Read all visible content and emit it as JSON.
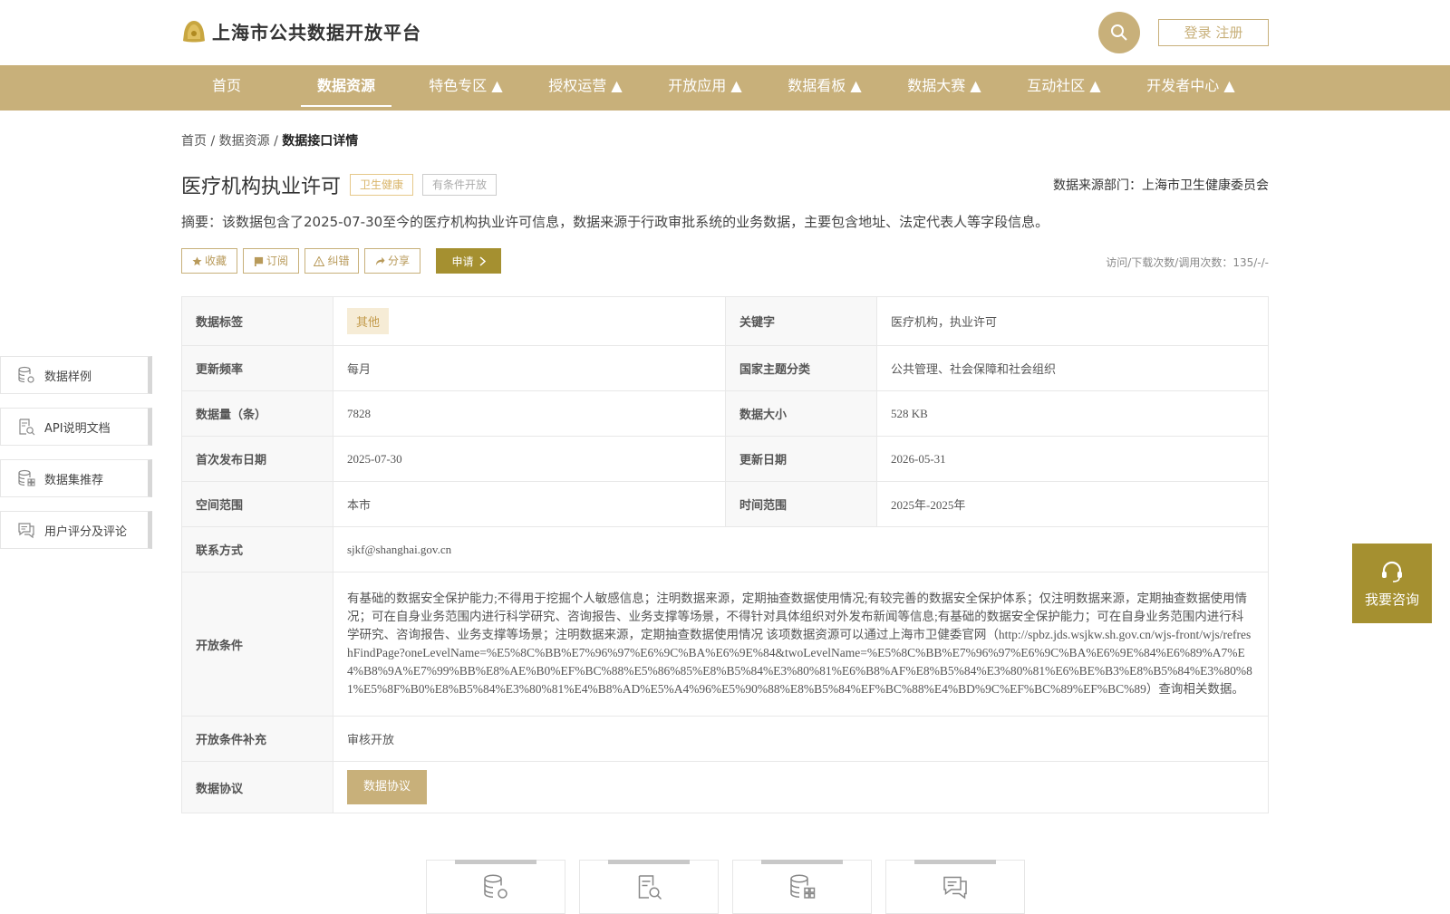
{
  "header": {
    "site_title": "上海市公共数据开放平台",
    "login_label": "登录 注册"
  },
  "nav": {
    "items": [
      {
        "label": "首页"
      },
      {
        "label": "数据资源"
      },
      {
        "label": "特色专区 ▲"
      },
      {
        "label": "授权运营 ▲"
      },
      {
        "label": "开放应用 ▲"
      },
      {
        "label": "数据看板 ▲"
      },
      {
        "label": "数据大赛 ▲"
      },
      {
        "label": "互动社区 ▲"
      },
      {
        "label": "开发者中心 ▲"
      }
    ],
    "active_index": 1
  },
  "breadcrumb": {
    "home": "首页",
    "sep1": "/",
    "section": "数据资源",
    "sep2": "/",
    "current": "数据接口详情"
  },
  "detail": {
    "title": "医疗机构执业许可",
    "tag_category": "卫生健康",
    "tag_open": "有条件开放",
    "source": "数据来源部门：上海市卫生健康委员会",
    "summary": "摘要：该数据包含了2025-07-30至今的医疗机构执业许可信息，数据来源于行政审批系统的业务数据，主要包含地址、法定代表人等字段信息。",
    "actions": {
      "collect": "收藏",
      "subscribe": "订阅",
      "correct": "纠错",
      "share": "分享",
      "apply": "申请"
    },
    "counts": "访问/下载次数/调用次数：135/-/-"
  },
  "table": {
    "tag_label": "数据标签",
    "tag_value": "其他",
    "keyword_label": "关键字",
    "keyword_value": "医疗机构，执业许可",
    "freq_label": "更新频率",
    "freq_value": "每月",
    "theme_label": "国家主题分类",
    "theme_value": "公共管理、社会保障和社会组织",
    "count_label": "数据量（条）",
    "count_value": "7828",
    "size_label": "数据大小",
    "size_value": "528 KB",
    "first_pub_label": "首次发布日期",
    "first_pub_value": "2025-07-30",
    "update_label": "更新日期",
    "update_value": "2026-05-31",
    "space_label": "空间范围",
    "space_value": "本市",
    "time_label": "时间范围",
    "time_value": "2025年-2025年",
    "contact_label": "联系方式",
    "contact_value": "sjkf@shanghai.gov.cn",
    "cond_label": "开放条件",
    "cond_value": "有基础的数据安全保护能力;不得用于挖掘个人敏感信息；注明数据来源，定期抽查数据使用情况;有较完善的数据安全保护体系；仅注明数据来源，定期抽查数据使用情况；可在自身业务范围内进行科学研究、咨询报告、业务支撑等场景，不得针对具体组织对外发布新闻等信息;有基础的数据安全保护能力；可在自身业务范围内进行科学研究、咨询报告、业务支撑等场景；注明数据来源，定期抽查数据使用情况 该项数据资源可以通过上海市卫健委官网（http://spbz.jds.wsjkw.sh.gov.cn/wjs-front/wjs/refreshFindPage?oneLevelName=%E5%8C%BB%E7%96%97%E6%9C%BA%E6%9E%84&twoLevelName=%E5%8C%BB%E7%96%97%E6%9C%BA%E6%9E%84%E6%89%A7%E4%B8%9A%E7%99%BB%E8%AE%B0%EF%BC%88%E5%86%85%E8%B5%84%E3%80%81%E6%B8%AF%E8%B5%84%E3%80%81%E6%BE%B3%E8%B5%84%E3%80%81%E5%8F%B0%E8%B5%84%E3%80%81%E4%B8%AD%E5%A4%96%E5%90%88%E8%B5%84%EF%BC%88%E4%BD%9C%EF%BC%89%EF%BC%89）查询相关数据。",
    "cond_supp_label": "开放条件补充",
    "cond_supp_value": "审核开放",
    "protocol_label": "数据协议",
    "protocol_button": "数据协议"
  },
  "sidebar": {
    "items": [
      {
        "label": "数据样例",
        "icon": "database-gear-icon"
      },
      {
        "label": "API说明文档",
        "icon": "doc-search-icon"
      },
      {
        "label": "数据集推荐",
        "icon": "database-grid-icon"
      },
      {
        "label": "用户评分及评论",
        "icon": "comment-icon"
      }
    ]
  },
  "consult": {
    "label": "我要咨询",
    "icon": "headset-icon"
  },
  "colors": {
    "brand": "#c8b07a",
    "apply": "#a59030",
    "tag_health": "#d9b56a"
  }
}
